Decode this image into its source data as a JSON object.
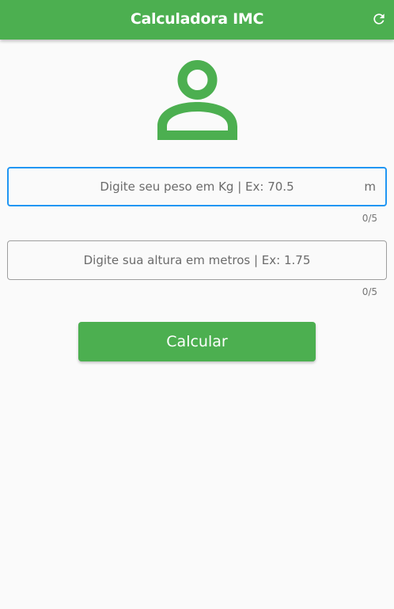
{
  "app_bar": {
    "title": "Calculadora IMC",
    "refresh_icon": "refresh-icon"
  },
  "header_icon": "person-icon",
  "colors": {
    "primary": "#4caf50",
    "focus": "#2196f3",
    "background": "#fafafa"
  },
  "weight_field": {
    "placeholder": "Digite seu peso em Kg | Ex: 70.5",
    "value": "",
    "suffix": "m",
    "counter": "0/5"
  },
  "height_field": {
    "placeholder": "Digite sua altura em metros | Ex: 1.75",
    "value": "",
    "counter": "0/5"
  },
  "calculate_button": {
    "label": "Calcular"
  }
}
